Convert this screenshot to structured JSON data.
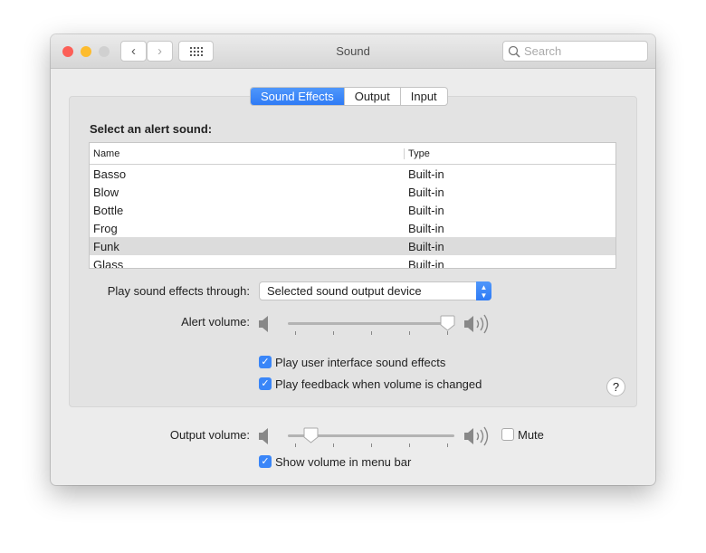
{
  "window": {
    "title": "Sound",
    "search_placeholder": "Search"
  },
  "tabs": [
    {
      "label": "Sound Effects",
      "selected": true
    },
    {
      "label": "Output"
    },
    {
      "label": "Input"
    }
  ],
  "alert": {
    "heading": "Select an alert sound:",
    "columns": [
      "Name",
      "Type"
    ],
    "rows": [
      {
        "name": "Basso",
        "type": "Built-in"
      },
      {
        "name": "Blow",
        "type": "Built-in"
      },
      {
        "name": "Bottle",
        "type": "Built-in"
      },
      {
        "name": "Frog",
        "type": "Built-in"
      },
      {
        "name": "Funk",
        "type": "Built-in",
        "selected": true
      },
      {
        "name": "Glass",
        "type": "Built-in"
      }
    ]
  },
  "play_through": {
    "label": "Play sound effects through:",
    "value": "Selected sound output device"
  },
  "alert_volume": {
    "label": "Alert volume:",
    "value_percent": 100
  },
  "checks": {
    "ui_sounds": {
      "label": "Play user interface sound effects",
      "checked": true
    },
    "feedback": {
      "label": "Play feedback when volume is changed",
      "checked": true
    }
  },
  "output_volume": {
    "label": "Output volume:",
    "value_percent": 10,
    "mute_label": "Mute",
    "mute_checked": false
  },
  "menu_bar": {
    "label": "Show volume in menu bar",
    "checked": true
  },
  "colors": {
    "accent": "#3a86f8"
  }
}
